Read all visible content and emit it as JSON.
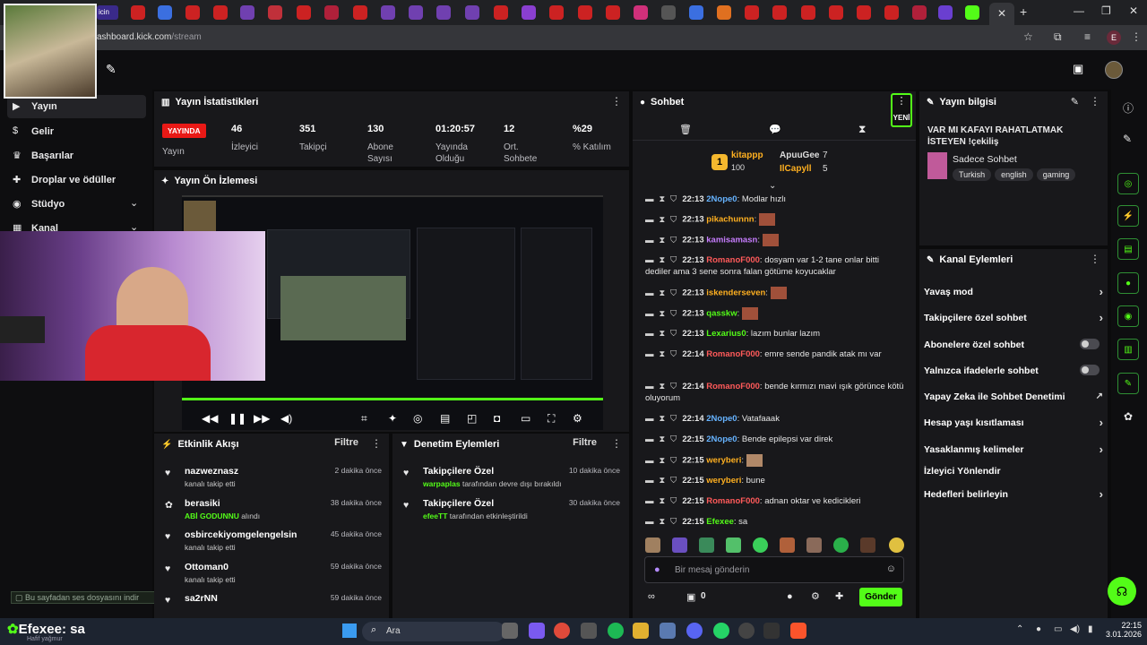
{
  "browser": {
    "address": "dashboard.kick.com/stream",
    "address_prefix": "ashboard.kick.com",
    "address_suffix": "/stream",
    "tab_partial": "icin"
  },
  "sidebar": {
    "items": [
      {
        "label": "Yayın",
        "icon": "broadcast-icon",
        "active": true
      },
      {
        "label": "Gelir",
        "icon": "dollar-icon"
      },
      {
        "label": "Başarılar",
        "icon": "trophy-icon"
      },
      {
        "label": "Droplar ve ödüller",
        "icon": "gift-icon"
      },
      {
        "label": "Stüdyo",
        "icon": "studio-icon"
      },
      {
        "label": "Kanal",
        "icon": "channel-icon"
      }
    ],
    "notice": "Bu sayfadan ses dosyasını indir"
  },
  "stats": {
    "title": "Yayın İstatistikleri",
    "live_badge": "YAYINDA",
    "live_label": "Yayın",
    "items": [
      {
        "value": "46",
        "label": "İzleyici"
      },
      {
        "value": "351",
        "label": "Takipçi"
      },
      {
        "value": "130",
        "label": "Abone Sayısı"
      },
      {
        "value": "01:20:57",
        "label": "Yayında Olduğu"
      },
      {
        "value": "12",
        "label": "Ort. Sohbete"
      },
      {
        "value": "%29",
        "label": "% Katılım"
      }
    ]
  },
  "preview": {
    "title": "Yayın Ön İzlemesi"
  },
  "activity": {
    "title": "Etkinlik Akışı",
    "filter": "Filtre",
    "items": [
      {
        "name": "nazweznasz",
        "detail": "kanalı takip etti",
        "time": "2 dakika önce",
        "icon": "heart-icon"
      },
      {
        "name": "berasiki",
        "detail_green": "ABİ GODUNNU",
        "detail": "alındı",
        "time": "38 dakika önce",
        "icon": "gift-icon"
      },
      {
        "name": "osbircekiyomgelengelsin",
        "detail": "kanalı takip etti",
        "time": "45 dakika önce",
        "icon": "heart-icon"
      },
      {
        "name": "Ottoman0",
        "detail": "kanalı takip etti",
        "time": "59 dakika önce",
        "icon": "heart-icon"
      },
      {
        "name": "sa2rNN",
        "detail": "",
        "time": "59 dakika önce",
        "icon": "heart-icon"
      }
    ]
  },
  "moderation": {
    "title": "Denetim Eylemleri",
    "filter": "Filtre",
    "items": [
      {
        "name": "Takipçilere Özel",
        "user": "warpaplas",
        "detail": "tarafından devre dışı bırakıldı",
        "time": "10 dakika önce"
      },
      {
        "name": "Takipçilere Özel",
        "user": "efeeTT",
        "detail": "tarafından etkinleştirildi",
        "time": "30 dakika önce"
      }
    ]
  },
  "chat": {
    "title": "Sohbet",
    "new_badge": "YENİ",
    "leaders": [
      {
        "name": "kitappp",
        "count": "100"
      },
      {
        "name": "ApuuGee",
        "count": "7"
      },
      {
        "name": "IlCapyll",
        "count": "5"
      }
    ],
    "messages": [
      {
        "time": "22:13",
        "user": "2Nope0",
        "color": "#66b3ff",
        "text": ": Modlar hızlı"
      },
      {
        "time": "22:13",
        "user": "pikachunnn",
        "color": "#ffb020",
        "text": ":"
      },
      {
        "time": "22:13",
        "user": "kamisamasn",
        "color": "#c77dff",
        "text": ":"
      },
      {
        "time": "22:13",
        "user": "RomanoF000",
        "color": "#ff4d4d",
        "text": ": dosyam var 1-2 tane onlar bitti dediler ama 3 sene sonra falan götüme koyucaklar"
      },
      {
        "time": "22:13",
        "user": "iskenderseven",
        "color": "#ffb020",
        "text": ":"
      },
      {
        "time": "22:13",
        "user": "qasskw",
        "color": "#53fc18",
        "text": ":"
      },
      {
        "time": "22:13",
        "user": "Lexarius0",
        "color": "#53fc18",
        "text": ": lazım bunlar lazım"
      },
      {
        "time": "22:14",
        "user": "RomanoF000",
        "color": "#ff4d4d",
        "text": ": emre sende pandik atak mı var"
      },
      {
        "time": "22:14",
        "user": "RomanoF000",
        "color": "#ff4d4d",
        "text": ": bende kırmızı mavi ışık görünce kötü oluyorum"
      },
      {
        "time": "22:14",
        "user": "2Nope0",
        "color": "#66b3ff",
        "text": ": Vatafaaak"
      },
      {
        "time": "22:15",
        "user": "2Nope0",
        "color": "#66b3ff",
        "text": ": Bende epilepsi var direk"
      },
      {
        "time": "22:15",
        "user": "weryberi",
        "color": "#ffb020",
        "text": ":"
      },
      {
        "time": "22:15",
        "user": "weryberi",
        "color": "#ffb020",
        "text": ": bune"
      },
      {
        "time": "22:15",
        "user": "RomanoF000",
        "color": "#ff4d4d",
        "text": ": adnan oktar ve kedicikleri"
      },
      {
        "time": "22:15",
        "user": "Efexee",
        "color": "#53fc18",
        "text": ": sa"
      }
    ],
    "placeholder": "Bir mesaj gönderin",
    "points": "0",
    "send": "Gönder"
  },
  "stream_info": {
    "title": "Yayın bilgisi",
    "stream_title": "VAR MI KAFAYI RAHATLATMAK İSTEYEN !çekiliş",
    "category": "Sadece Sohbet",
    "tags": [
      "Turkish",
      "english",
      "gaming"
    ]
  },
  "channel_actions": {
    "title": "Kanal Eylemleri",
    "items": [
      {
        "label": "Yavaş mod",
        "control": "chevron"
      },
      {
        "label": "Takipçilere özel sohbet",
        "control": "chevron"
      },
      {
        "label": "Abonelere özel sohbet",
        "control": "toggle"
      },
      {
        "label": "Yalnızca ifadelerle sohbet",
        "control": "toggle"
      },
      {
        "label": "Yapay Zeka ile Sohbet Denetimi",
        "control": "external"
      },
      {
        "label": "Hesap yaşı kısıtlaması",
        "control": "chevron"
      },
      {
        "label": "Yasaklanmış kelimeler",
        "control": "chevron"
      },
      {
        "label": "İzleyici Yönlendir",
        "control": "none"
      },
      {
        "label": "Hedefleri belirleyin",
        "control": "chevron"
      }
    ]
  },
  "overlay": {
    "chat_name": "Efexee",
    "chat_text": ": sa",
    "small_label": "Hafif yağmur"
  },
  "taskbar": {
    "search": "Ara",
    "time": "22:15",
    "date": "3.01.2026"
  },
  "colors": {
    "accent": "#53fc18",
    "panel": "#18181b",
    "live": "#e91916"
  }
}
